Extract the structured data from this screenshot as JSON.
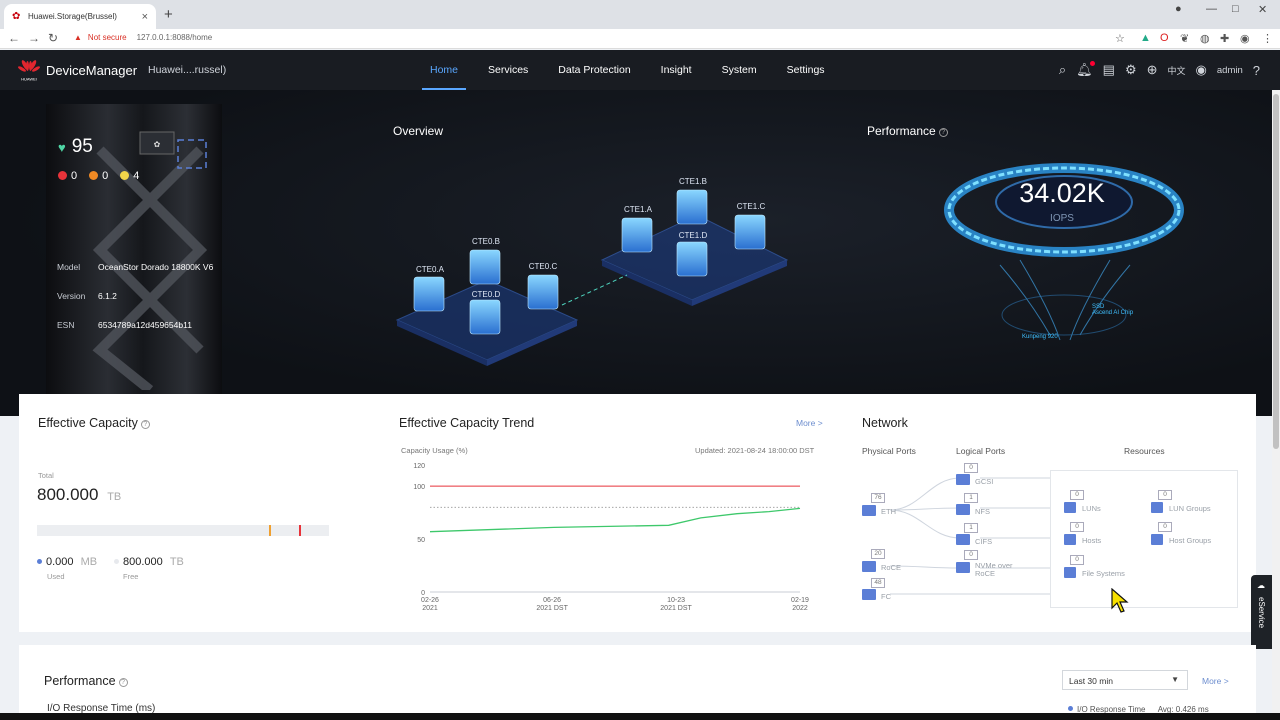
{
  "browser": {
    "tab_title": "Huawei.Storage(Brussel)",
    "security": "Not secure",
    "url": "127.0.0.1:8088/home"
  },
  "header": {
    "brand": "DeviceManager",
    "device_name": "Huawei....russel)",
    "nav": [
      "Home",
      "Services",
      "Data Protection",
      "Insight",
      "System",
      "Settings"
    ],
    "lang": "中文",
    "user": "admin"
  },
  "hero": {
    "health_score": "95",
    "alarms": {
      "critical": "0",
      "major": "0",
      "warning": "4"
    },
    "device": {
      "model_label": "Model",
      "model": "OceanStor Dorado 18800K V6",
      "version_label": "Version",
      "version": "6.1.2",
      "esn_label": "ESN",
      "esn": "6534789a12d459654b11"
    },
    "overview_title": "Overview",
    "controllers": [
      "CTE0.A",
      "CTE0.B",
      "CTE0.C",
      "CTE0.D",
      "CTE1.A",
      "CTE1.B",
      "CTE1.C",
      "CTE1.D"
    ],
    "performance_title": "Performance",
    "iops_value": "34.02K",
    "iops_label": "IOPS",
    "gauge_labels": [
      "Kunpeng 920",
      "SSD",
      "Ascend AI Chip"
    ]
  },
  "capacity": {
    "title": "Effective Capacity",
    "total_label": "Total",
    "total_value": "800.000",
    "total_unit": "TB",
    "used_value": "0.000",
    "used_unit": "MB",
    "used_label": "Used",
    "free_value": "800.000",
    "free_unit": "TB",
    "free_label": "Free"
  },
  "trend": {
    "title": "Effective Capacity Trend",
    "more": "More >",
    "y_label": "Capacity Usage (%)",
    "updated": "Updated: 2021-08-24 18:00:00 DST"
  },
  "chart_data": {
    "type": "line",
    "ylabel": "Capacity Usage (%)",
    "ylim": [
      0,
      120
    ],
    "y_ticks": [
      0,
      50,
      100,
      120
    ],
    "x_ticks": [
      {
        "date": "02-26",
        "sub": "2021"
      },
      {
        "date": "06-26",
        "sub": "2021 DST"
      },
      {
        "date": "10-23",
        "sub": "2021 DST"
      },
      {
        "date": "02-19",
        "sub": "2022"
      }
    ],
    "x_range": [
      "2021-02-26",
      "2022-02-19"
    ],
    "threshold_red": 100,
    "threshold_dotted": 80,
    "series": [
      {
        "color": "#3ec86b",
        "points": [
          [
            "2021-02-26",
            57
          ],
          [
            "2021-06-26",
            61
          ],
          [
            "2021-10-15",
            63
          ],
          [
            "2021-11-15",
            70
          ],
          [
            "2021-12-20",
            74
          ],
          [
            "2022-01-20",
            76
          ],
          [
            "2022-02-19",
            79
          ]
        ]
      }
    ]
  },
  "network": {
    "title": "Network",
    "physical_title": "Physical Ports",
    "logical_title": "Logical Ports",
    "resources_title": "Resources",
    "physical": [
      {
        "name": "ETH",
        "count": "76"
      },
      {
        "name": "RoCE",
        "count": "20"
      },
      {
        "name": "FC",
        "count": "48"
      }
    ],
    "logical": [
      {
        "name": "GCSI",
        "count": "0"
      },
      {
        "name": "NFS",
        "count": "1"
      },
      {
        "name": "CIFS",
        "count": "1"
      },
      {
        "name": "NVMe over RoCE",
        "count": "0"
      }
    ],
    "resources": [
      {
        "name": "LUNs",
        "count": "0"
      },
      {
        "name": "LUN Groups",
        "count": "0"
      },
      {
        "name": "Hosts",
        "count": "0"
      },
      {
        "name": "Host Groups",
        "count": "0"
      },
      {
        "name": "File Systems",
        "count": "0"
      }
    ]
  },
  "eservice": "eService",
  "performance": {
    "title": "Performance",
    "range": "Last 30 min",
    "more": "More >",
    "metric": "I/O Response Time (ms)",
    "legend": "I/O Response Time",
    "avg": "Avg:  0.426 ms"
  }
}
